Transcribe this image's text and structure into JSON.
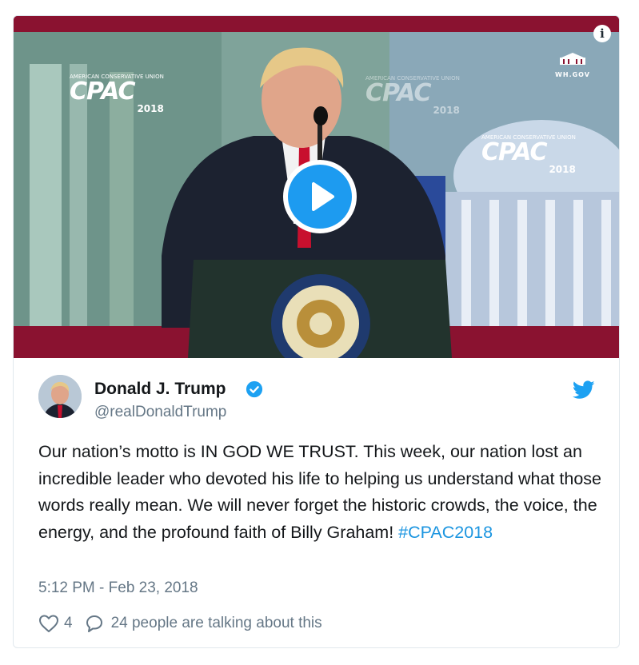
{
  "video": {
    "info_label": "i",
    "watermark": "WH.GOV",
    "cpac_logos": [
      {
        "org": "American Conservative Union",
        "name": "CPAC",
        "year": "2018"
      },
      {
        "org": "American Conservative Union",
        "name": "CPAC",
        "year": "2018"
      },
      {
        "org": "American Conservative Union",
        "name": "CPAC",
        "year": "2018"
      }
    ],
    "seal_text": "PRESIDENT OF THE UNITED STATES"
  },
  "author": {
    "display_name": "Donald J. Trump",
    "handle": "@realDonaldTrump",
    "verified": true
  },
  "tweet": {
    "text": "Our nation’s motto is IN GOD WE TRUST. This week, our nation lost an incredible leader who devoted his life to helping us understand what those words really mean. We will never forget the historic crowds, the voice, the energy, and the profound faith of Billy Graham! ",
    "hashtag": "#CPAC2018",
    "timestamp": "5:12 PM - Feb 23, 2018"
  },
  "engagement": {
    "likes": "4",
    "conversation": "24 people are talking about this"
  },
  "colors": {
    "accent": "#1b95e0",
    "play_button": "#1d9bf0",
    "muted_text": "#657786",
    "video_frame": "#8a1230"
  },
  "icons": [
    "info-icon",
    "play-icon",
    "verified-icon",
    "twitter-bird-icon",
    "heart-icon",
    "comment-icon"
  ]
}
